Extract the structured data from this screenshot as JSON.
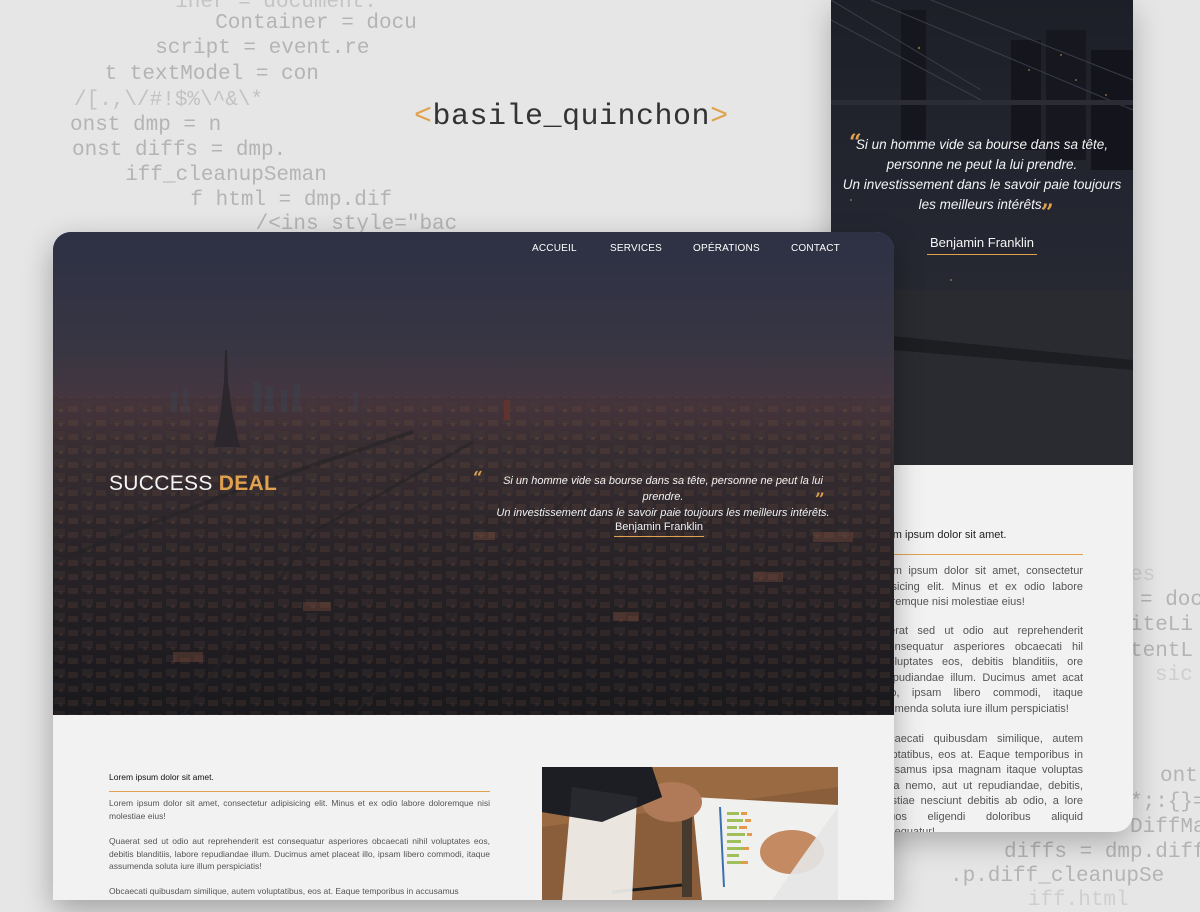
{
  "background_code": [
    "  iner = document.",
    "  Container = docu",
    "  script = event.re",
    " t textModel = con",
    "/[.,\\/#!$%\\^&\\*",
    "onst dmp = n",
    "onst diffs = dmp.",
    "  iff_cleanupSeman",
    "    f html = dmp.dif",
    "      /<ins style=\"bac"
  ],
  "background_code_right": [
    "es",
    "= doc",
    "iteLi",
    "tentL",
    "sic",
    "ont",
    "*;:{}=",
    "DiffMa",
    "diffs = dmp.diff",
    ".p.diff_cleanupSe",
    "   iff.html"
  ],
  "brand": {
    "open": "<",
    "name": "basile_quinchon",
    "close": ">"
  },
  "desktop": {
    "nav": [
      "ACCUEIL",
      "SERVICES",
      "OPÉRATIONS",
      "CONTACT"
    ],
    "logo": {
      "part1": "SUCCESS ",
      "part2": "DEAL"
    },
    "quote": {
      "open_mark": "“",
      "line1": "Si un homme vide sa bourse dans sa tête, personne ne peut la lui prendre.",
      "line2": "Un investissement dans le savoir paie toujours les meilleurs intérêts.",
      "close_mark": "”",
      "author": "Benjamin Franklin"
    },
    "content": {
      "heading": "Lorem ipsum dolor sit amet.",
      "para1": "Lorem ipsum dolor sit amet, consectetur adipisicing elit. Minus et ex odio labore doloremque nisi molestiae eius!",
      "para2": "Quaerat sed ut odio aut reprehenderit est consequatur asperiores obcaecati nihil voluptates eos, debitis blanditiis, labore repudiandae illum. Ducimus amet placeat illo, ipsam libero commodi, itaque assumenda soluta iure illum perspiciatis!",
      "para3": "Obcaecati quibusdam similique, autem voluptatibus, eos at. Eaque temporibus in accusamus"
    }
  },
  "mobile": {
    "quote": {
      "open_mark": "“",
      "line1": "Si un homme vide sa bourse dans sa tête,",
      "line2": "personne ne peut la lui prendre.",
      "line3": "Un investissement dans le savoir paie toujours",
      "line4": "les meilleurs intérêts.",
      "close_mark": "”",
      "author": "Benjamin Franklin"
    },
    "content": {
      "heading": "rem ipsum dolor sit amet.",
      "para1": "rem ipsum dolor sit amet, consectetur pisicing elit. Minus et ex odio labore loremque nisi molestiae eius!",
      "para2": "aerat sed ut odio aut reprehenderit consequatur asperiores obcaecati hil voluptates eos, debitis blanditiis, ore repudiandae illum. Ducimus amet acat illo, ipsam libero commodi, itaque sumenda soluta iure illum perspiciatis!",
      "para3": "ocaecati quibusdam similique, autem luptatibus, eos at. Eaque temporibus in cusamus ipsa magnam itaque voluptas icia nemo, aut ut repudiandae, debitis, lestiae nesciunt debitis ab odio, a lore quos eligendi doloribus aliquid nsequatur!"
    }
  },
  "colors": {
    "accent": "#e0a24f",
    "page_bg": "#e6e6e6",
    "content_bg": "#f2f2f2"
  }
}
